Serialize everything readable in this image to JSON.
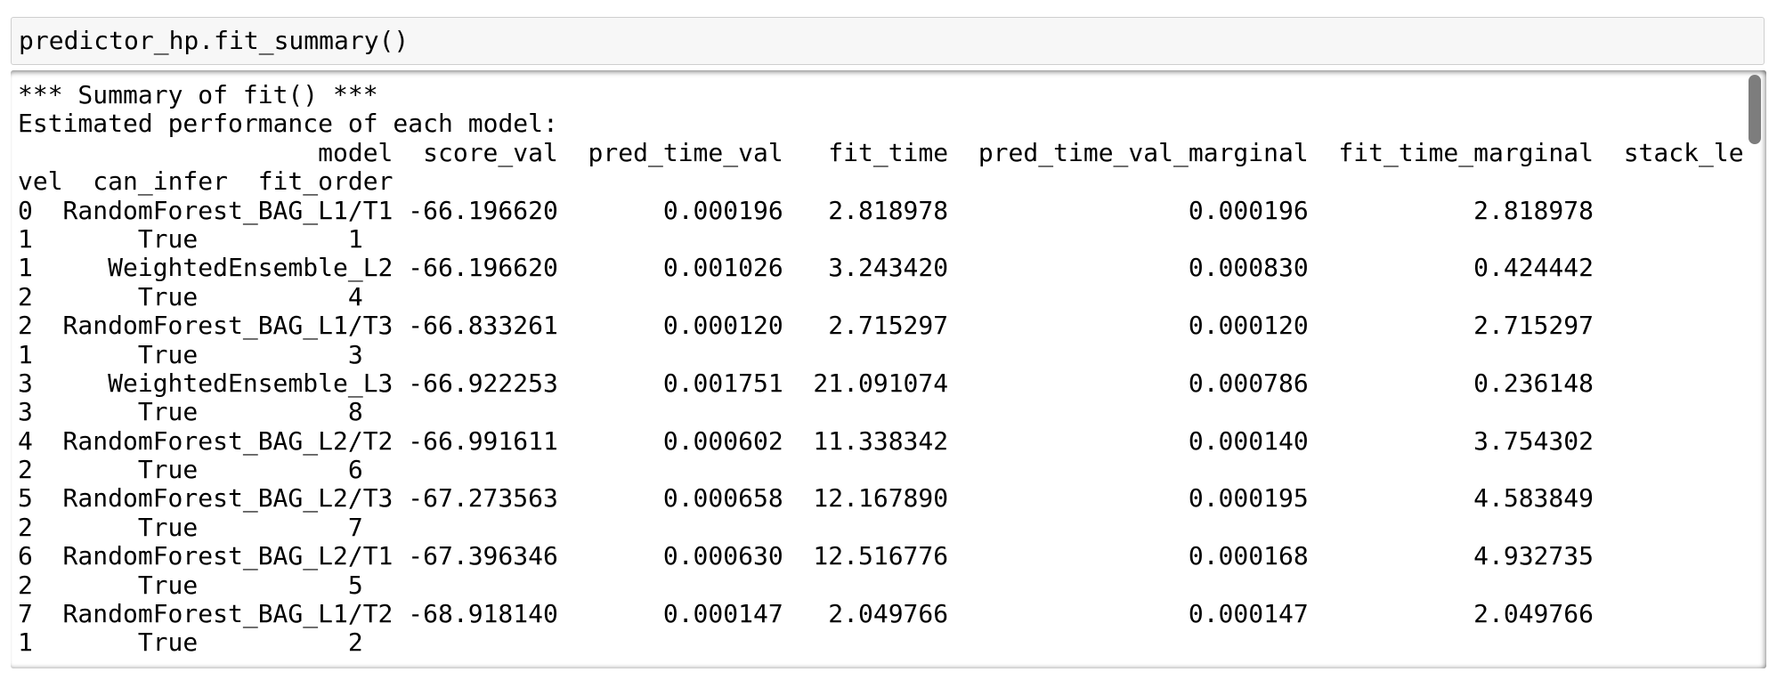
{
  "input": {
    "code": "predictor_hp.fit_summary()"
  },
  "output": {
    "title_line": "*** Summary of fit() ***",
    "subtitle_line": "Estimated performance of each model:",
    "columns": [
      "model",
      "score_val",
      "pred_time_val",
      "fit_time",
      "pred_time_val_marginal",
      "fit_time_marginal",
      "stack_le"
    ],
    "columns_wrapped": [
      "vel",
      "can_infer",
      "fit_order"
    ],
    "rows": [
      {
        "index": "0",
        "model": "RandomForest_BAG_L1/T1",
        "score_val": "-66.196620",
        "pred_time_val": "0.000196",
        "fit_time": "2.818978",
        "pred_time_val_marginal": "0.000196",
        "fit_time_marginal": "2.818978",
        "stack_level": "1",
        "can_infer": "True",
        "fit_order": "1"
      },
      {
        "index": "1",
        "model": "WeightedEnsemble_L2",
        "score_val": "-66.196620",
        "pred_time_val": "0.001026",
        "fit_time": "3.243420",
        "pred_time_val_marginal": "0.000830",
        "fit_time_marginal": "0.424442",
        "stack_level": "2",
        "can_infer": "True",
        "fit_order": "4"
      },
      {
        "index": "2",
        "model": "RandomForest_BAG_L1/T3",
        "score_val": "-66.833261",
        "pred_time_val": "0.000120",
        "fit_time": "2.715297",
        "pred_time_val_marginal": "0.000120",
        "fit_time_marginal": "2.715297",
        "stack_level": "1",
        "can_infer": "True",
        "fit_order": "3"
      },
      {
        "index": "3",
        "model": "WeightedEnsemble_L3",
        "score_val": "-66.922253",
        "pred_time_val": "0.001751",
        "fit_time": "21.091074",
        "pred_time_val_marginal": "0.000786",
        "fit_time_marginal": "0.236148",
        "stack_level": "3",
        "can_infer": "True",
        "fit_order": "8"
      },
      {
        "index": "4",
        "model": "RandomForest_BAG_L2/T2",
        "score_val": "-66.991611",
        "pred_time_val": "0.000602",
        "fit_time": "11.338342",
        "pred_time_val_marginal": "0.000140",
        "fit_time_marginal": "3.754302",
        "stack_level": "2",
        "can_infer": "True",
        "fit_order": "6"
      },
      {
        "index": "5",
        "model": "RandomForest_BAG_L2/T3",
        "score_val": "-67.273563",
        "pred_time_val": "0.000658",
        "fit_time": "12.167890",
        "pred_time_val_marginal": "0.000195",
        "fit_time_marginal": "4.583849",
        "stack_level": "2",
        "can_infer": "True",
        "fit_order": "7"
      },
      {
        "index": "6",
        "model": "RandomForest_BAG_L2/T1",
        "score_val": "-67.396346",
        "pred_time_val": "0.000630",
        "fit_time": "12.516776",
        "pred_time_val_marginal": "0.000168",
        "fit_time_marginal": "4.932735",
        "stack_level": "2",
        "can_infer": "True",
        "fit_order": "5"
      },
      {
        "index": "7",
        "model": "RandomForest_BAG_L1/T2",
        "score_val": "-68.918140",
        "pred_time_val": "0.000147",
        "fit_time": "2.049766",
        "pred_time_val_marginal": "0.000147",
        "fit_time_marginal": "2.049766",
        "stack_level": "1",
        "can_infer": "True",
        "fit_order": "2"
      }
    ]
  },
  "colors": {
    "input_bg": "#f7f7f7",
    "input_border": "#cfcfcf",
    "scrollbar": "#7d7d7d",
    "text": "#000000"
  }
}
